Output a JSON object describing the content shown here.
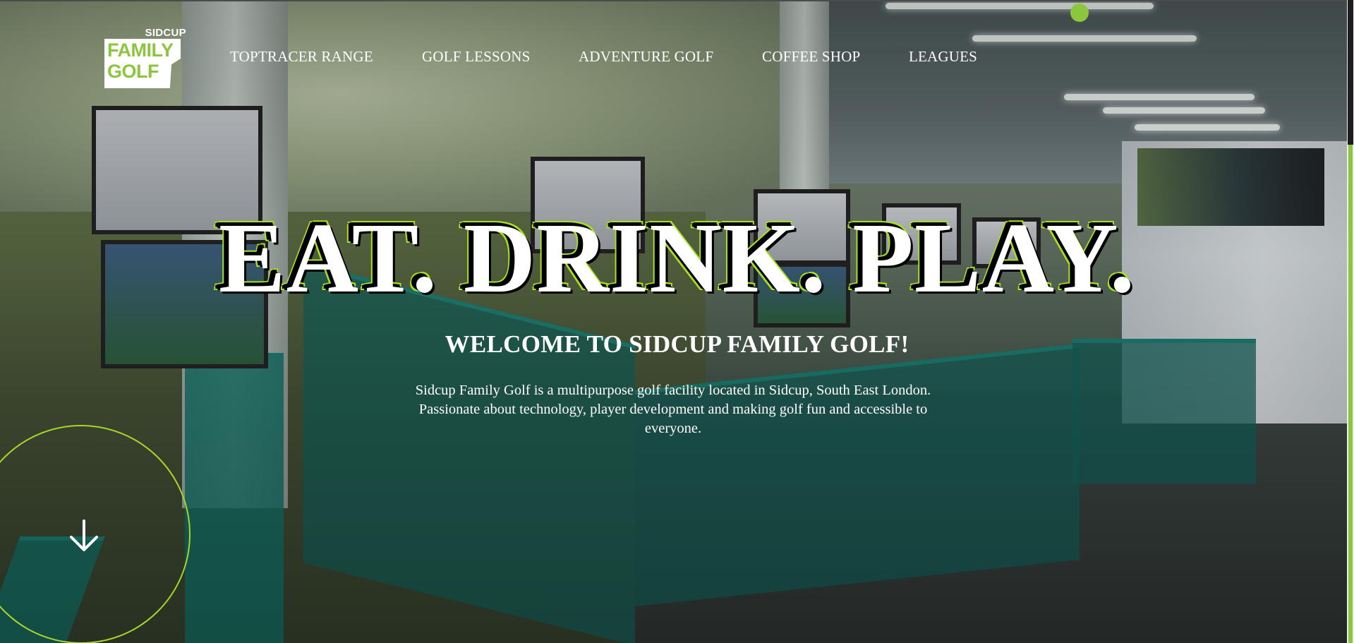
{
  "colors": {
    "accent_green": "#8cc63f",
    "hero_outline_green": "#a6e01f",
    "text": "#ffffff"
  },
  "logo": {
    "top_text": "SIDCUP",
    "line1": "FAMILY",
    "line2": "GOLF"
  },
  "nav": {
    "items": [
      {
        "label": "TOPTRACER RANGE"
      },
      {
        "label": "GOLF LESSONS"
      },
      {
        "label": "ADVENTURE GOLF"
      },
      {
        "label": "COFFEE SHOP"
      },
      {
        "label": "LEAGUES"
      }
    ]
  },
  "hero": {
    "title": "EAT. DRINK. PLAY.",
    "subtitle": "WELCOME TO SIDCUP FAMILY GOLF!",
    "description": "Sidcup Family Golf is a multipurpose golf facility located in Sidcup, South East London. Passionate about technology, player development and making golf fun and accessible to everyone."
  },
  "scroll": {
    "icon": "arrow-down-icon"
  }
}
